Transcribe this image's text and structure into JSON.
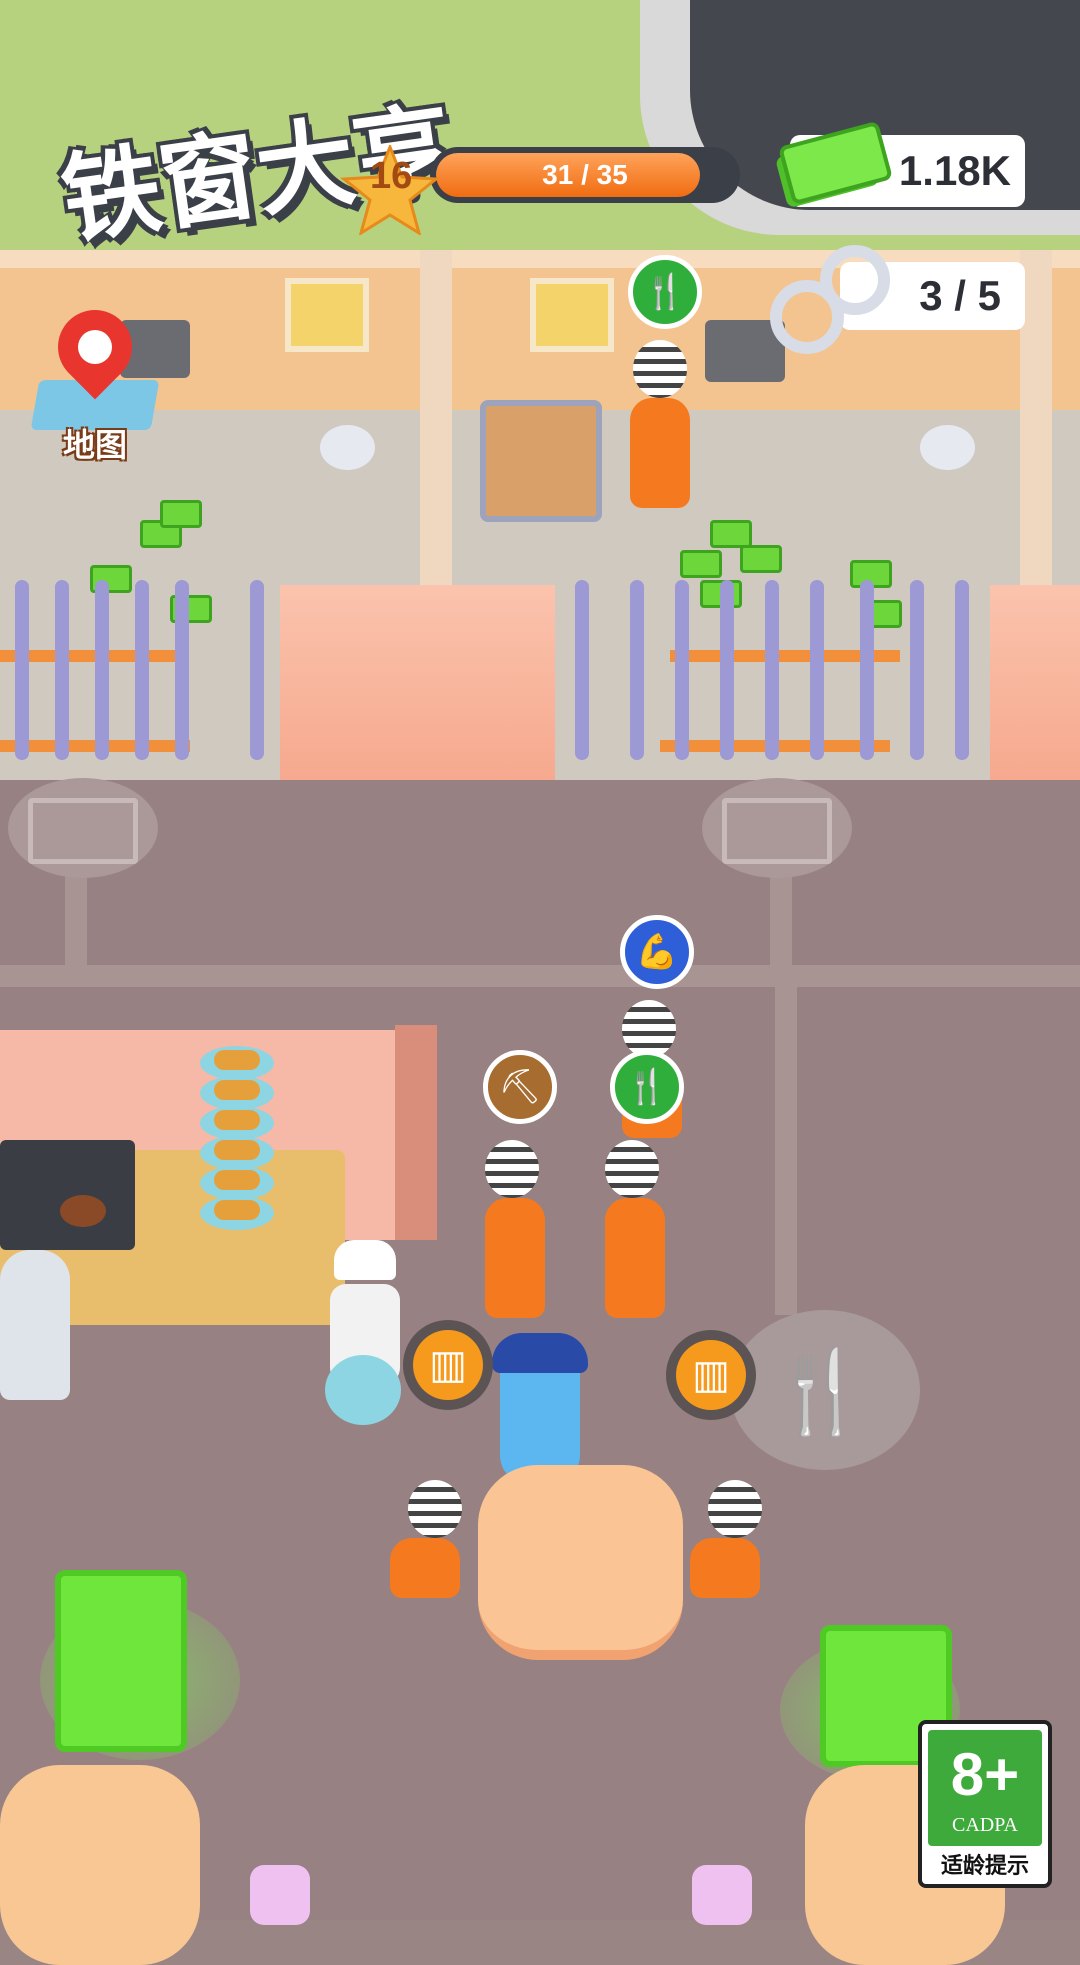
{
  "game": {
    "title": "铁窗大亨",
    "level": "16",
    "progress": {
      "text": "31 / 35",
      "current": 31,
      "total": 35
    },
    "currency": {
      "amount": "1.18K",
      "icon": "cash-stack-icon"
    },
    "prisoners": {
      "text": "3 / 5",
      "icon": "handcuffs-icon"
    },
    "map_button": {
      "label": "地图",
      "icon": "map-pin-icon"
    },
    "age_rating": {
      "rating": "8+",
      "org": "CADPA",
      "note": "适龄提示"
    }
  },
  "bubbles": [
    {
      "name": "food-request-icon",
      "glyph": "🍴",
      "color": "#2fae3b"
    },
    {
      "name": "strength-request-icon",
      "glyph": "💪",
      "color": "#2f5fd8"
    },
    {
      "name": "pickaxe-request-icon",
      "glyph": "⛏",
      "color": "#a76c30"
    },
    {
      "name": "food-request-icon",
      "glyph": "🍴",
      "color": "#2fae3b"
    },
    {
      "name": "food-request-icon",
      "glyph": "🍴",
      "color": "#2fae3b"
    }
  ],
  "colors": {
    "accent_orange": "#f06c11",
    "prisoner_orange": "#f57a1f",
    "cash_green": "#6ee63c",
    "hud_dark": "#3b3f47"
  }
}
